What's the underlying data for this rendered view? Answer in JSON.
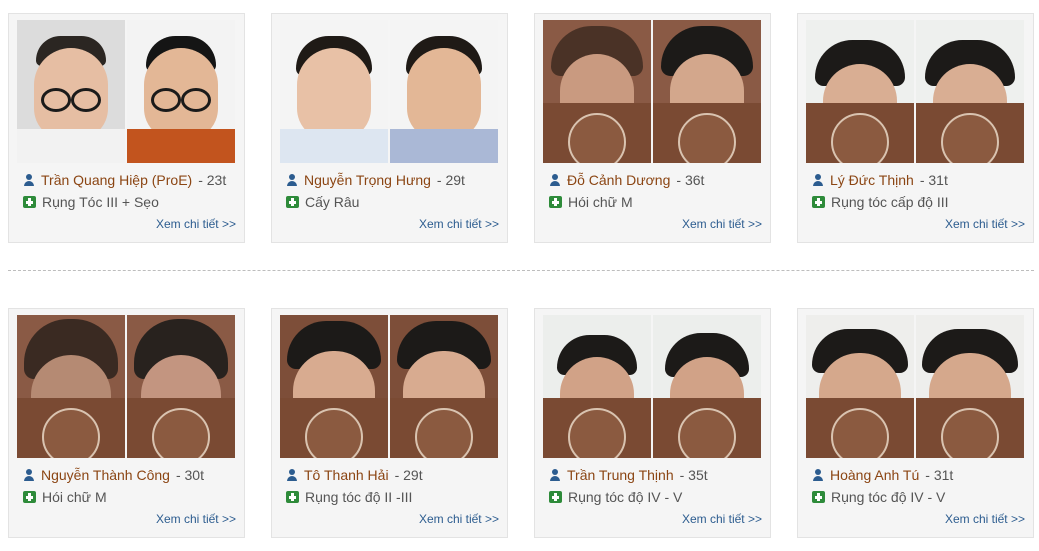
{
  "detail_label": "Xem chi tiết >>",
  "cards": [
    {
      "name": "Trần Quang Hiệp (ProE)",
      "age": "- 23t",
      "condition": "Rụng Tóc III + Sẹo"
    },
    {
      "name": "Nguyễn Trọng Hưng",
      "age": "- 29t",
      "condition": "Cấy Râu"
    },
    {
      "name": "Đỗ Cảnh Dương",
      "age": "- 36t",
      "condition": "Hói chữ M"
    },
    {
      "name": "Lý Đức Thịnh",
      "age": "- 31t",
      "condition": "Rụng tóc cấp độ III"
    },
    {
      "name": "Nguyễn Thành Công",
      "age": "- 30t",
      "condition": "Hói chữ M"
    },
    {
      "name": "Tô Thanh Hải",
      "age": "- 29t",
      "condition": "Rụng tóc độ II -III"
    },
    {
      "name": "Trần Trung Thịnh",
      "age": "- 35t",
      "condition": "Rụng tóc độ IV - V"
    },
    {
      "name": "Hoàng Anh Tú",
      "age": "- 31t",
      "condition": "Rụng tóc độ IV - V"
    }
  ],
  "colors": {
    "name": "#8b4513",
    "link": "#2c5c8f",
    "user_icon": "#2c5c8f",
    "medkit_icon": "#2e8b3a"
  },
  "icons": {
    "person": "user-icon",
    "condition": "medkit-icon"
  }
}
